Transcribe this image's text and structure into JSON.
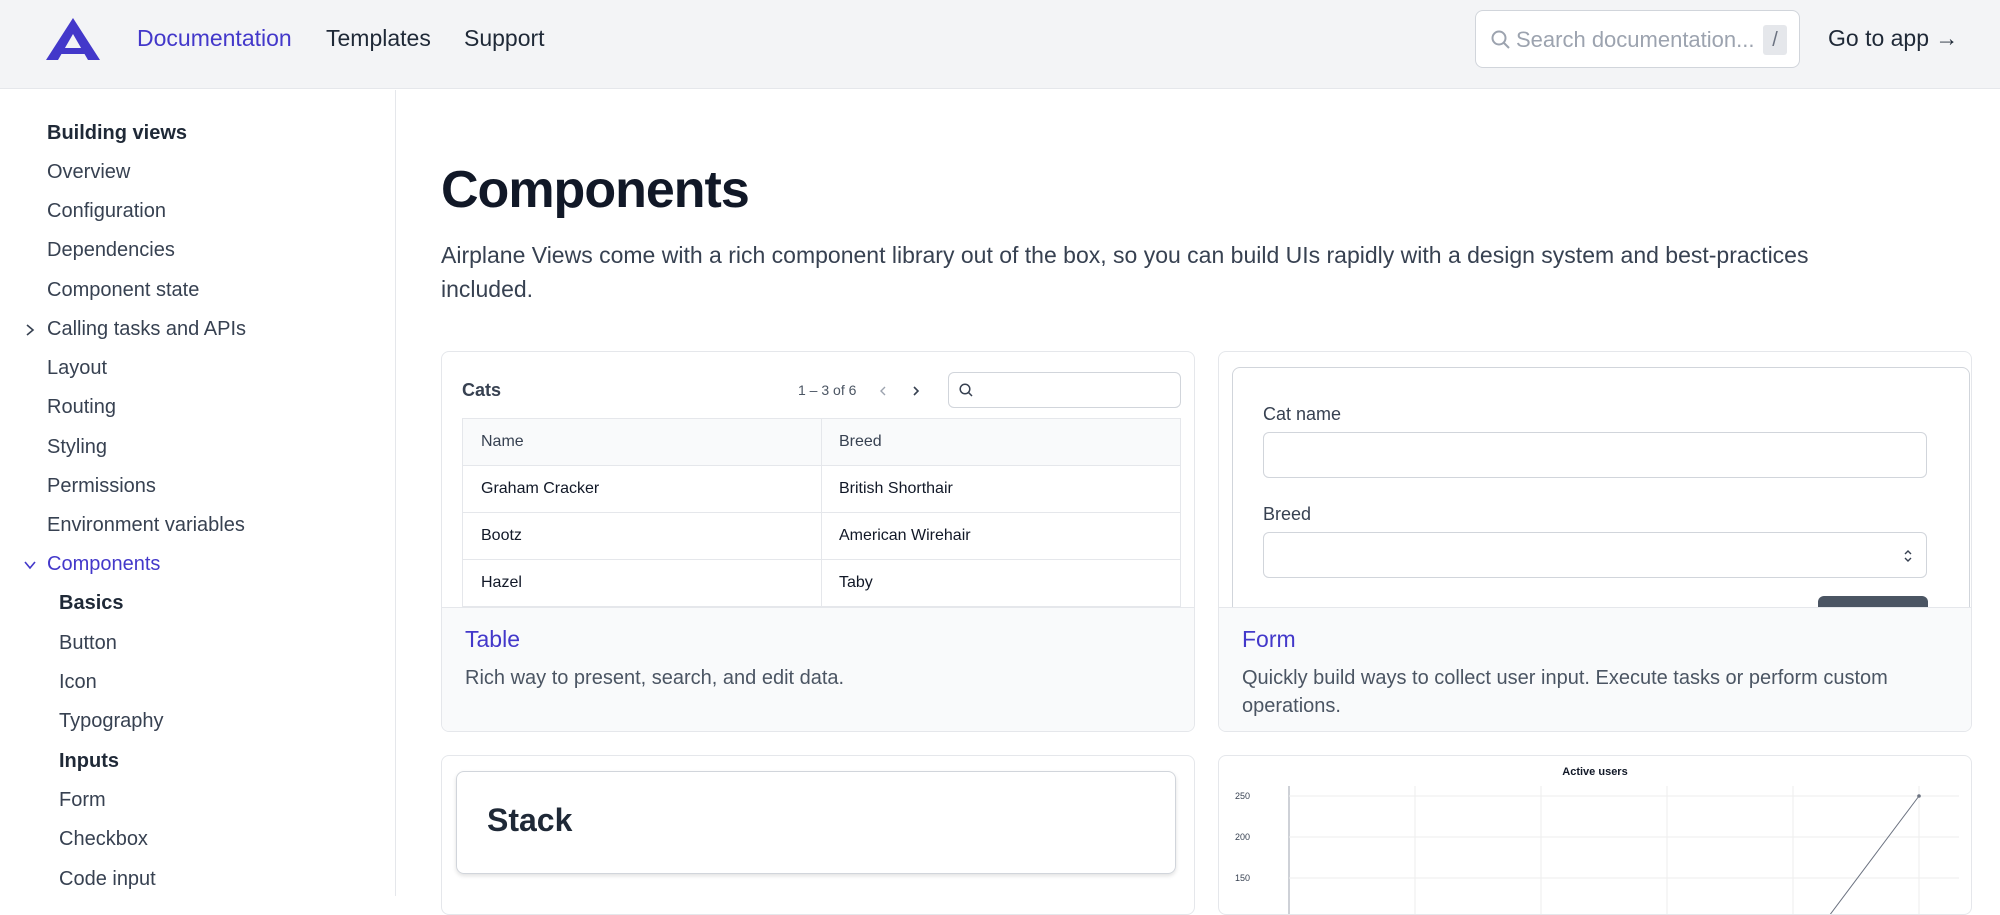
{
  "header": {
    "nav": [
      "Documentation",
      "Templates",
      "Support"
    ],
    "search_placeholder": "Search documentation...",
    "search_shortcut": "/",
    "go_to_app": "Go to app →"
  },
  "sidebar": {
    "section": "Building views",
    "items": [
      {
        "label": "Overview"
      },
      {
        "label": "Configuration"
      },
      {
        "label": "Dependencies"
      },
      {
        "label": "Component state"
      },
      {
        "label": "Calling tasks and APIs"
      },
      {
        "label": "Layout"
      },
      {
        "label": "Routing"
      },
      {
        "label": "Styling"
      },
      {
        "label": "Permissions"
      },
      {
        "label": "Environment variables"
      },
      {
        "label": "Components"
      }
    ],
    "sub": [
      {
        "label": "Basics"
      },
      {
        "label": "Button"
      },
      {
        "label": "Icon"
      },
      {
        "label": "Typography"
      },
      {
        "label": "Inputs"
      },
      {
        "label": "Form"
      },
      {
        "label": "Checkbox"
      },
      {
        "label": "Code input"
      }
    ]
  },
  "main": {
    "title": "Components",
    "lead": "Airplane Views come with a rich component library out of the box, so you can build UIs rapidly with a design system and best-practices included."
  },
  "cards": {
    "table": {
      "title": "Table",
      "desc": "Rich way to present, search, and edit data.",
      "preview": {
        "title": "Cats",
        "pagination": "1 – 3 of 6",
        "columns": [
          "Name",
          "Breed"
        ],
        "rows": [
          [
            "Graham Cracker",
            "British Shorthair"
          ],
          [
            "Bootz",
            "American Wirehair"
          ],
          [
            "Hazel",
            "Taby"
          ]
        ]
      }
    },
    "form": {
      "title": "Form",
      "desc": "Quickly build ways to collect user input. Execute tasks or perform custom operations.",
      "preview": {
        "field1": "Cat name",
        "field2": "Breed"
      }
    },
    "stack": {
      "preview_text": "Stack"
    },
    "chart": {
      "preview_title": "Active users"
    }
  },
  "chart_data": {
    "type": "line",
    "title": "Active users",
    "yticks": [
      "250",
      "200",
      "150"
    ],
    "ylim": [
      150,
      250
    ],
    "grid": true
  },
  "colors": {
    "accent": "#4338ca"
  }
}
